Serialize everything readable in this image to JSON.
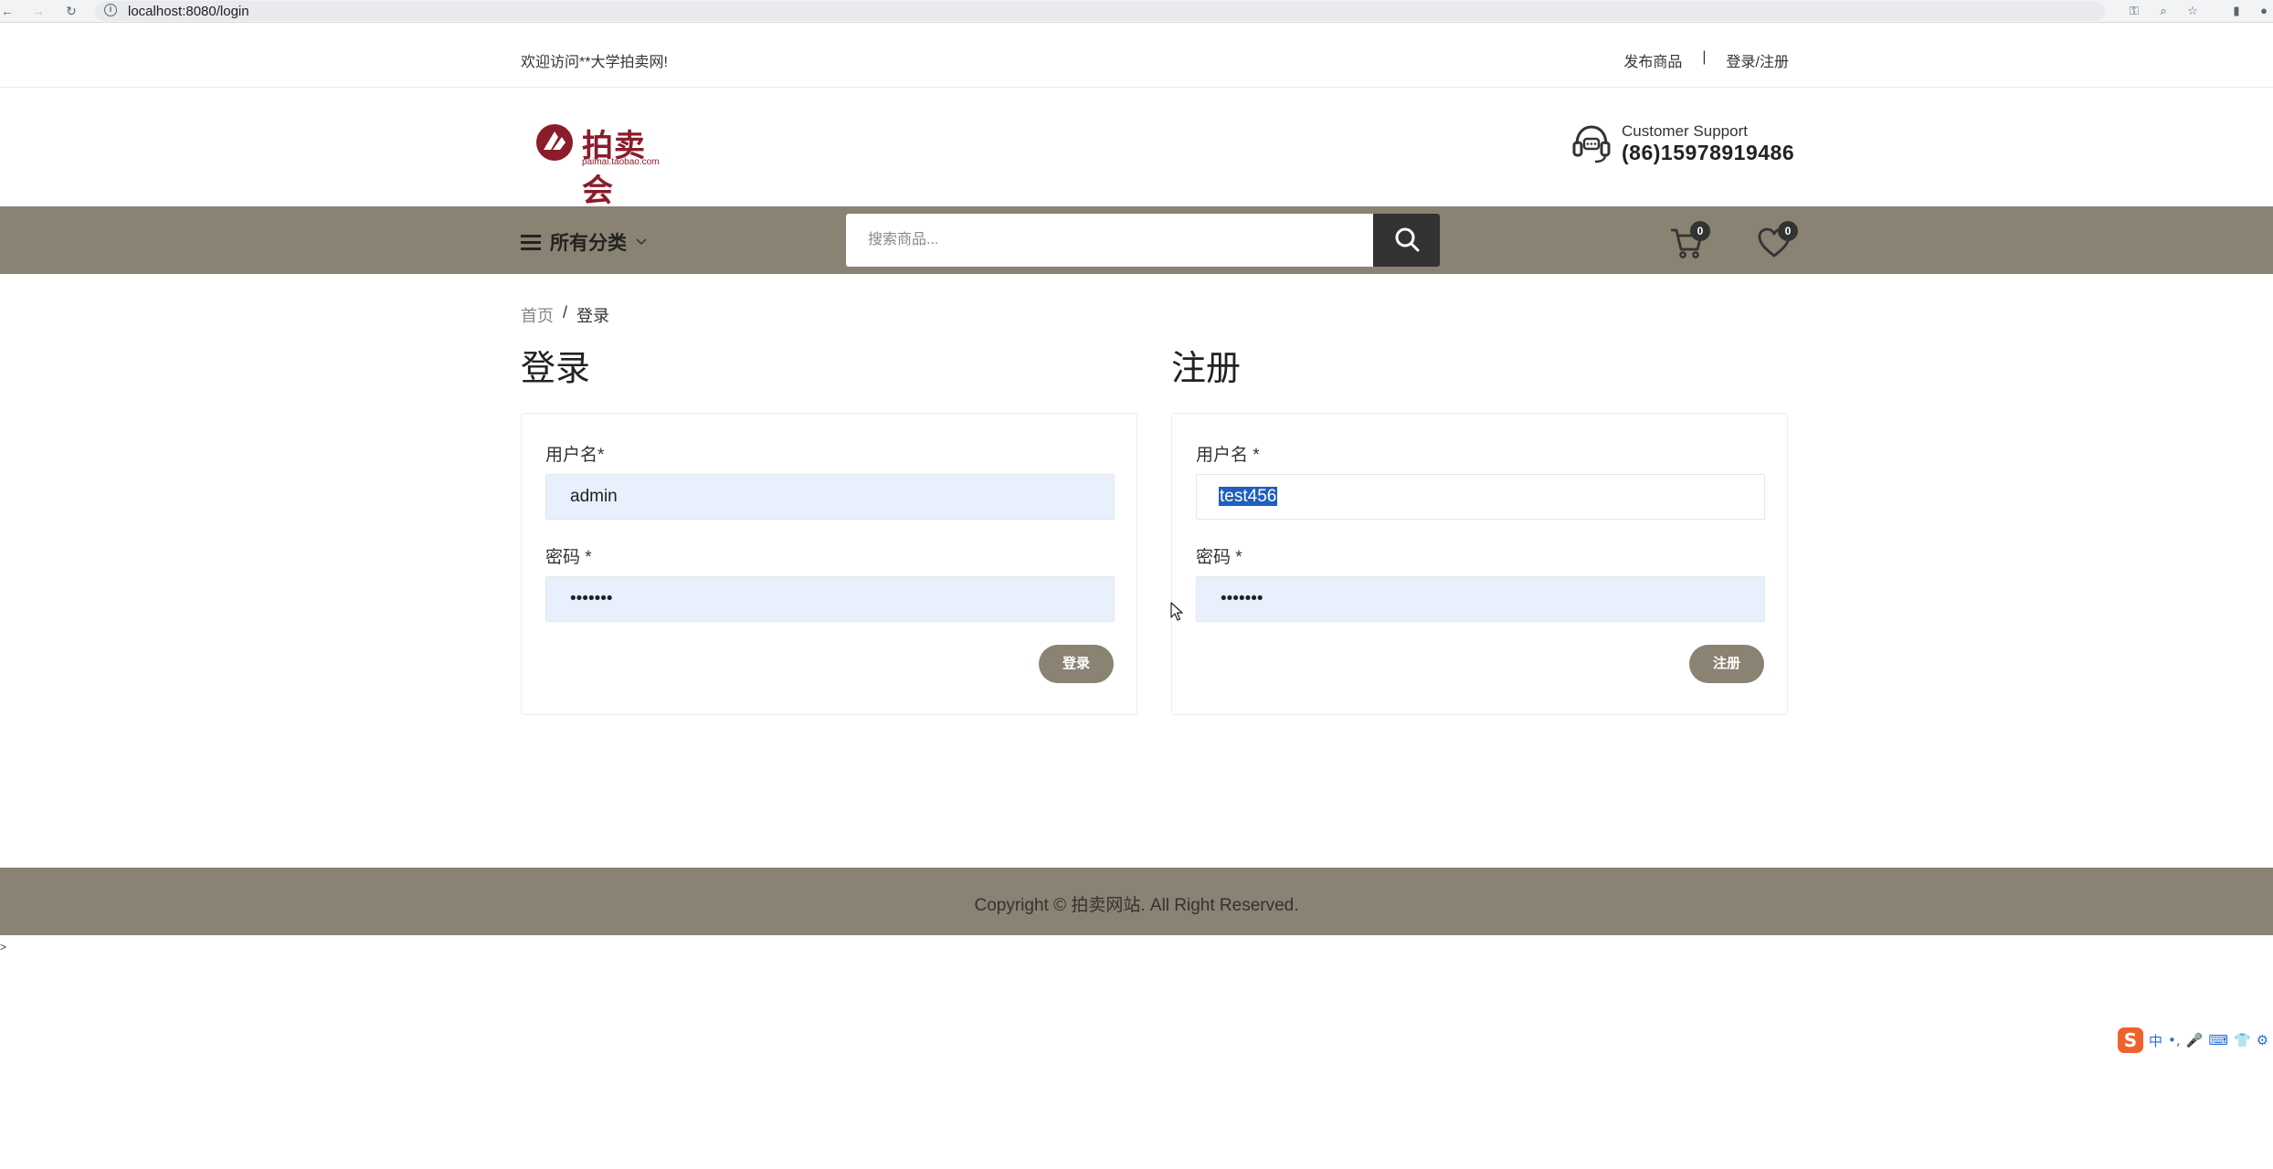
{
  "browser": {
    "url": "localhost:8080/login"
  },
  "topbar": {
    "welcome": "欢迎访问**大学拍卖网!",
    "publish_link": "发布商品",
    "separator": "|",
    "login_register_link": "登录/注册"
  },
  "header": {
    "logo_text": "拍卖会",
    "logo_subtext": "paimai.taobao.com",
    "support_label": "Customer Support",
    "support_phone": "(86)15978919486"
  },
  "navbar": {
    "categories_label": "所有分类",
    "search_placeholder": "搜索商品...",
    "cart_count": "0",
    "wishlist_count": "0"
  },
  "breadcrumb": {
    "home": "首页",
    "separator": "/",
    "current": "登录"
  },
  "login": {
    "title": "登录",
    "username_label": "用户名*",
    "username_value": "admin",
    "password_label": "密码 *",
    "password_value": "•••••••",
    "submit_label": "登录"
  },
  "register": {
    "title": "注册",
    "username_label": "用户名 *",
    "username_value": "test456",
    "password_label": "密码 *",
    "password_value": "•••••••",
    "submit_label": "注册"
  },
  "footer": {
    "copyright": "Copyright © 拍卖网站. All Right Reserved."
  },
  "stray_text": ">",
  "ime": {
    "logo": "S",
    "items": [
      "中",
      "•,",
      "🎤",
      "⌨",
      "👕",
      "⚙"
    ]
  },
  "colors": {
    "accent": "#8a8272",
    "logo_red": "#8a1c2b",
    "input_autofill": "#e8f0fe",
    "selection": "#1f5fbf"
  }
}
